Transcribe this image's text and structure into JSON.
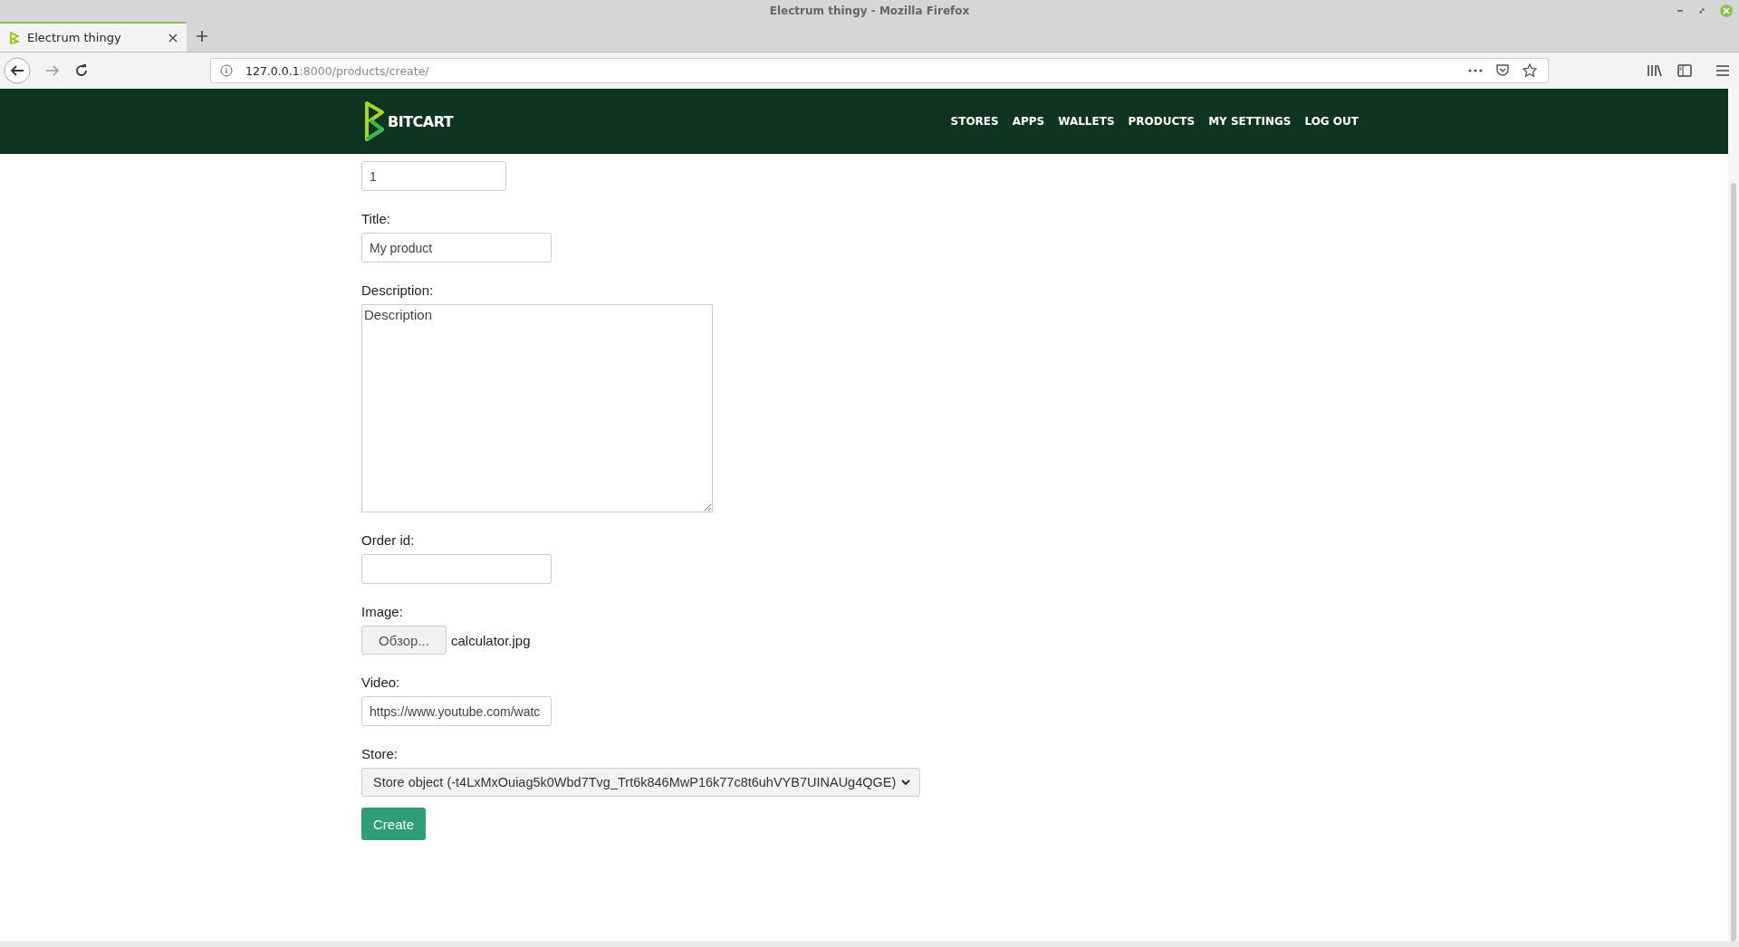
{
  "window": {
    "title": "Electrum thingy - Mozilla Firefox"
  },
  "tabs": [
    {
      "label": "Electrum thingy",
      "selected": true
    }
  ],
  "address_bar": {
    "host": "127.0.0.1",
    "path": ":8000/products/create/"
  },
  "site_nav": {
    "brand": "BITCART",
    "links": [
      "STORES",
      "APPS",
      "WALLETS",
      "PRODUCTS",
      "MY SETTINGS",
      "LOG OUT"
    ]
  },
  "form": {
    "fields": [
      {
        "kind": "number",
        "value": "1"
      },
      {
        "kind": "text",
        "label": "Title:",
        "value": "My product"
      },
      {
        "kind": "textarea",
        "label": "Description:",
        "value": "Description"
      },
      {
        "kind": "text",
        "label": "Order id:"
      },
      {
        "kind": "file",
        "label": "Image:",
        "button": "Обзор...",
        "value": "calculator.jpg"
      },
      {
        "kind": "text",
        "label": "Video:",
        "value": "https://www.youtube.com/watc"
      },
      {
        "kind": "select",
        "label": "Store:",
        "value": "Store object (-t4LxMxOuiag5k0Wbd7Tvg_Trt6k846MwP16k77c8t6uhVYB7UINAUg4QGE)"
      }
    ],
    "submit": "Create"
  }
}
